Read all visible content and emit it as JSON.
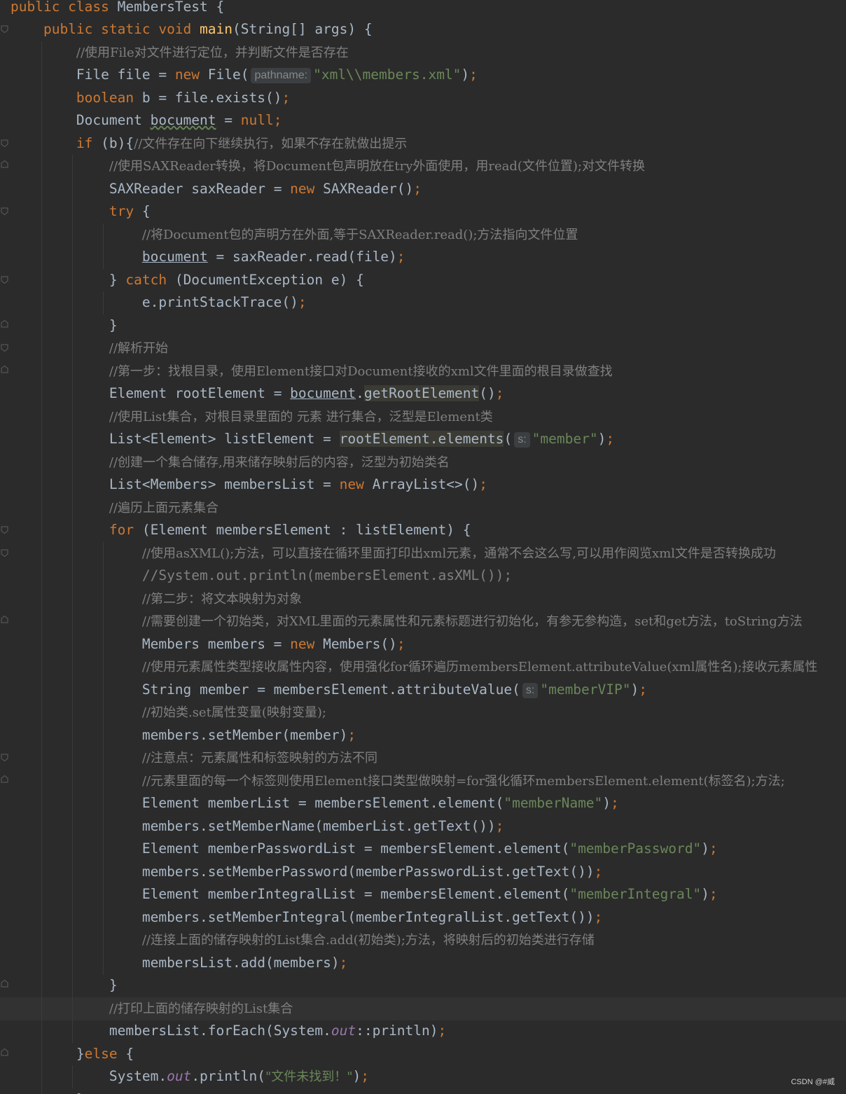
{
  "editor": {
    "language": "java",
    "theme": "darcula",
    "colors": {
      "background": "#2b2b2b",
      "keyword": "#cc7832",
      "method": "#ffc66d",
      "string": "#6a8759",
      "comment": "#808080",
      "static_field": "#9876aa",
      "default_text": "#a9b7c6"
    }
  },
  "hints": {
    "pathname": "pathname:",
    "s1": "s:",
    "s2": "s:"
  },
  "lines": {
    "l01": {
      "t1": "public class ",
      "t2": "MembersTest {"
    },
    "l02": {
      "t1": "public static void ",
      "t2": "main",
      "t3": "(String[] args) {"
    },
    "l03": {
      "t1": "//使用File对文件进行定位，并判断文件是否存在"
    },
    "l04": {
      "t1": "File file = ",
      "t2": "new ",
      "t3": "File(",
      "t4": "\"xml\\\\members.xml\"",
      "t5": ")",
      "t6": ";"
    },
    "l05": {
      "t1": "boolean ",
      "t2": "b = file.exists()",
      "t3": ";"
    },
    "l06": {
      "t1": "Document ",
      "t2": "bocument",
      "t3": " = ",
      "t4": "null;"
    },
    "l07": {
      "t1": "if ",
      "t2": "(b){",
      "t3": "//文件存在向下继续执行，如果不存在就做出提示"
    },
    "l08": {
      "t1": "//使用SAXReader转换，将Document包声明放在try外面使用，用read(文件位置);对文件转换"
    },
    "l09": {
      "t1": "SAXReader saxReader = ",
      "t2": "new ",
      "t3": "SAXReader()",
      "t4": ";"
    },
    "l10": {
      "t1": "try ",
      "t2": "{"
    },
    "l11": {
      "t1": "//将Document包的声明方在外面,等于SAXReader.read();方法指向文件位置"
    },
    "l12": {
      "t1": "bocument",
      "t2": " = saxReader.read(file)",
      "t3": ";"
    },
    "l13": {
      "t1": "} ",
      "t2": "catch ",
      "t3": "(DocumentException e) {"
    },
    "l14": {
      "t1": "e.printStackTrace()",
      "t2": ";"
    },
    "l15": {
      "t1": "}"
    },
    "l16": {
      "t1": "//解析开始"
    },
    "l17": {
      "t1": "//第一步：找根目录，使用Element接口对Document接收的xml文件里面的根目录做查找"
    },
    "l18": {
      "t1": "Element rootElement = ",
      "t2": "bocument",
      "t3": ".",
      "t4": "getRootElement",
      "t5": "()",
      "t6": ";"
    },
    "l19": {
      "t1": "//使用List集合，对根目录里面的 元素 进行集合，泛型是Element类"
    },
    "l20": {
      "t1": "List<Element> listElement = ",
      "t2": "rootElement.elements",
      "t3": "(",
      "t4": "\"member\"",
      "t5": ")",
      "t6": ";"
    },
    "l21": {
      "t1": "//创建一个集合储存,用来储存映射后的内容，泛型为初始类名"
    },
    "l22": {
      "t1": "List<Members> membersList = ",
      "t2": "new ",
      "t3": "ArrayList<>()",
      "t4": ";"
    },
    "l23": {
      "t1": "//遍历上面元素集合"
    },
    "l24": {
      "t1": "for ",
      "t2": "(Element membersElement : listElement) {"
    },
    "l25": {
      "t1": "//使用asXML();方法，可以直接在循环里面打印出xml元素，通常不会这么写,可以用作阅览xml文件是否转换成功"
    },
    "l26": {
      "t1": "//System.out.println(membersElement.asXML());"
    },
    "l27": {
      "t1": "//第二步：将文本映射为对象"
    },
    "l28": {
      "t1": "//需要创建一个初始类，对XML里面的元素属性和元素标题进行初始化，有参无参构造，set和get方法，toString方法"
    },
    "l29": {
      "t1": "Members members = ",
      "t2": "new ",
      "t3": "Members()",
      "t4": ";"
    },
    "l30": {
      "t1": "//使用元素属性类型接收属性内容，使用强化for循环遍历membersElement.attributeValue(xml属性名);接收元素属性"
    },
    "l31": {
      "t1": "String member = membersElement.attributeValue(",
      "t2": "\"memberVIP\"",
      "t3": ")",
      "t4": ";"
    },
    "l32": {
      "t1": "//初始类.set属性变量(映射变量);"
    },
    "l33": {
      "t1": "members.setMember(member)",
      "t2": ";"
    },
    "l34": {
      "t1": "//注意点：元素属性和标签映射的方法不同"
    },
    "l35": {
      "t1": "//元素里面的每一个标签则使用Element接口类型做映射=for强化循环membersElement.element(标签名);方法;"
    },
    "l36": {
      "t1": "Element memberList = membersElement.element(",
      "t2": "\"memberName\"",
      "t3": ")",
      "t4": ";"
    },
    "l37": {
      "t1": "members.setMemberName(memberList.getText())",
      "t2": ";"
    },
    "l38": {
      "t1": "Element memberPasswordList = membersElement.element(",
      "t2": "\"memberPassword\"",
      "t3": ")",
      "t4": ";"
    },
    "l39": {
      "t1": "members.setMemberPassword(memberPasswordList.getText())",
      "t2": ";"
    },
    "l40": {
      "t1": "Element memberIntegralList = membersElement.element(",
      "t2": "\"memberIntegral\"",
      "t3": ")",
      "t4": ";"
    },
    "l41": {
      "t1": "members.setMemberIntegral(memberIntegralList.getText())",
      "t2": ";"
    },
    "l42": {
      "t1": "//连接上面的储存映射的List集合.add(初始类);方法，将映射后的初始类进行存储"
    },
    "l43": {
      "t1": "membersList.add(members)",
      "t2": ";"
    },
    "l44": {
      "t1": "}"
    },
    "l45": {
      "t1": "//打印上面的储存映射的List集合"
    },
    "l46": {
      "t1": "membersList.forEach(System.",
      "t2": "out",
      "t3": "::println)",
      "t4": ";"
    },
    "l47": {
      "t1": "}",
      "t2": "else ",
      "t3": "{"
    },
    "l48": {
      "t1": "System.",
      "t2": "out",
      "t3": ".println(",
      "t4": "\"文件未找到！\"",
      "t5": ")",
      "t6": ";"
    },
    "l49": {
      "t1": "}"
    }
  },
  "watermark": "CSDN @#威"
}
